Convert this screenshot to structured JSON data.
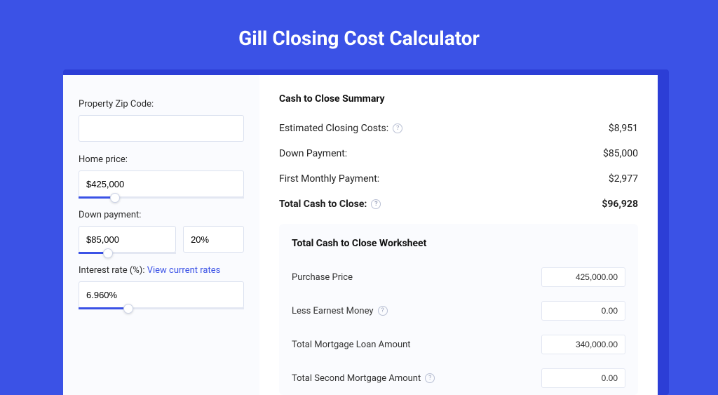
{
  "title": "Gill Closing Cost Calculator",
  "left": {
    "zip": {
      "label": "Property Zip Code:",
      "value": ""
    },
    "home_price": {
      "label": "Home price:",
      "value": "$425,000",
      "slider_pct": 22
    },
    "down_payment": {
      "label": "Down payment:",
      "amount": "$85,000",
      "pct": "20%",
      "slider_pct": 30
    },
    "interest": {
      "label": "Interest rate (%):",
      "link": "View current rates",
      "value": "6.960%",
      "slider_pct": 30
    }
  },
  "summary": {
    "title": "Cash to Close Summary",
    "rows": [
      {
        "label": "Estimated Closing Costs:",
        "help": true,
        "value": "$8,951"
      },
      {
        "label": "Down Payment:",
        "help": false,
        "value": "$85,000"
      },
      {
        "label": "First Monthly Payment:",
        "help": false,
        "value": "$2,977"
      }
    ],
    "total": {
      "label": "Total Cash to Close:",
      "help": true,
      "value": "$96,928"
    }
  },
  "worksheet": {
    "title": "Total Cash to Close Worksheet",
    "rows": [
      {
        "label": "Purchase Price",
        "help": false,
        "value": "425,000.00"
      },
      {
        "label": "Less Earnest Money",
        "help": true,
        "value": "0.00"
      },
      {
        "label": "Total Mortgage Loan Amount",
        "help": false,
        "value": "340,000.00"
      },
      {
        "label": "Total Second Mortgage Amount",
        "help": true,
        "value": "0.00"
      }
    ]
  }
}
